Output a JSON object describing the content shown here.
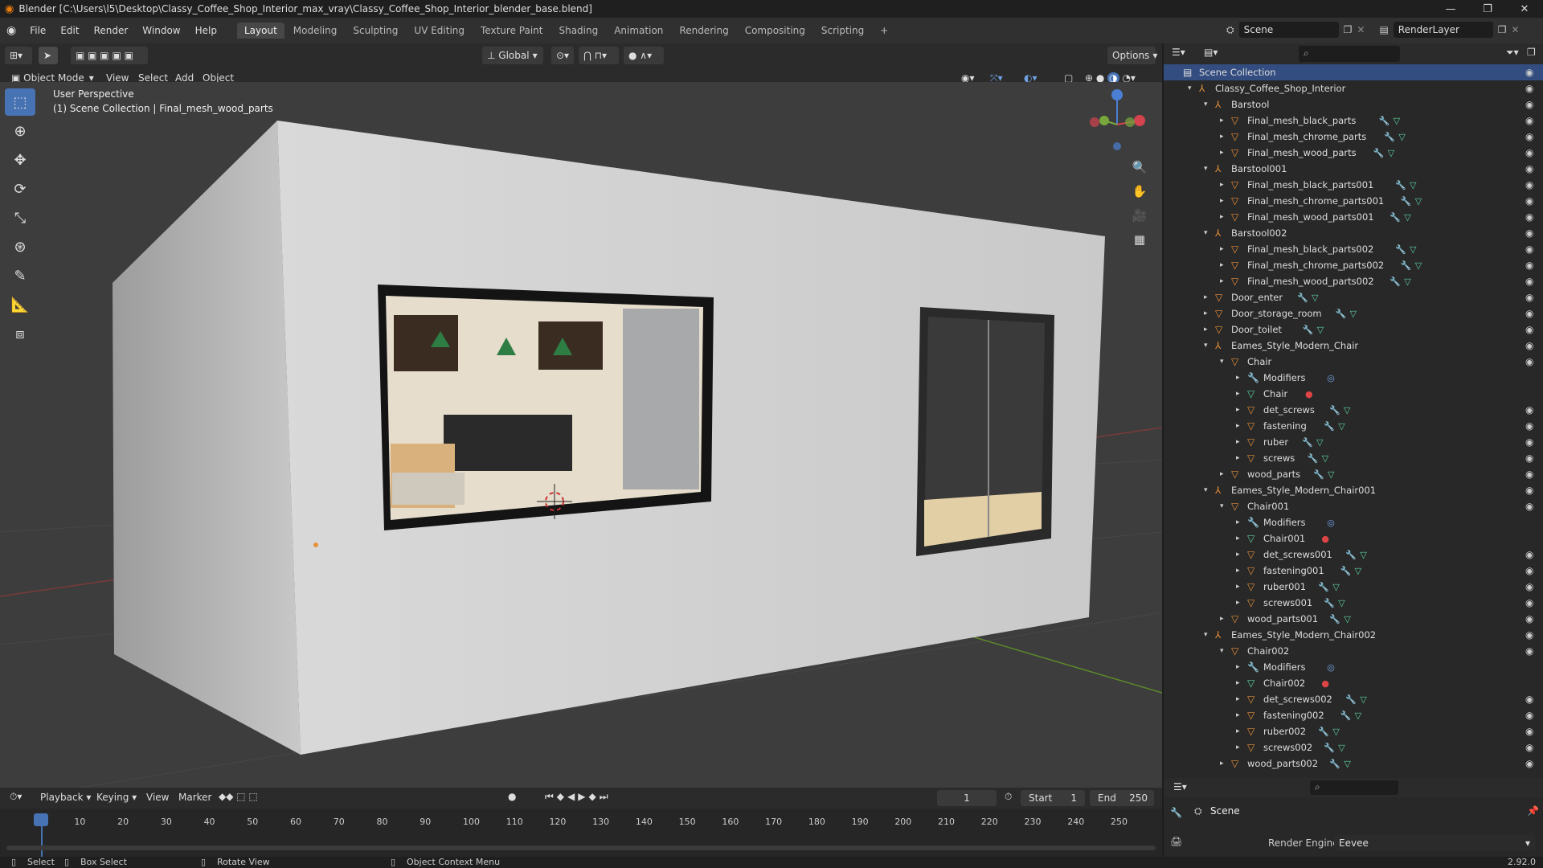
{
  "window": {
    "title": "Blender [C:\\Users\\l5\\Desktop\\Classy_Coffee_Shop_Interior_max_vray\\Classy_Coffee_Shop_Interior_blender_base.blend]",
    "minimize": "—",
    "restore": "❐",
    "close": "✕"
  },
  "menus": [
    "File",
    "Edit",
    "Render",
    "Window",
    "Help"
  ],
  "workspaces": [
    "Layout",
    "Modeling",
    "Sculpting",
    "UV Editing",
    "Texture Paint",
    "Shading",
    "Animation",
    "Rendering",
    "Compositing",
    "Scripting"
  ],
  "add_workspace": "+",
  "scene_name": "Scene",
  "render_layer": "RenderLayer",
  "viewport": {
    "mode": "Object Mode",
    "menu": [
      "View",
      "Select",
      "Add",
      "Object"
    ],
    "transform": "Global",
    "options": "Options",
    "perspective_label": "User Perspective",
    "collection_label": "(1) Scene Collection | Final_mesh_wood_parts"
  },
  "outliner": {
    "search_placeholder": "",
    "rows": [
      {
        "label": "Scene Collection",
        "type": "scene",
        "indent": 0,
        "selected": true
      },
      {
        "label": "Classy_Coffee_Shop_Interior",
        "type": "empty",
        "indent": 1,
        "arrow": "▾"
      },
      {
        "label": "Barstool",
        "type": "empty",
        "indent": 2,
        "arrow": "▾"
      },
      {
        "label": "Final_mesh_black_parts",
        "type": "mesh",
        "indent": 3,
        "arrow": "▸"
      },
      {
        "label": "Final_mesh_chrome_parts",
        "type": "mesh",
        "indent": 3,
        "arrow": "▸"
      },
      {
        "label": "Final_mesh_wood_parts",
        "type": "mesh",
        "indent": 3,
        "arrow": "▸"
      },
      {
        "label": "Barstool001",
        "type": "empty",
        "indent": 2,
        "arrow": "▾"
      },
      {
        "label": "Final_mesh_black_parts001",
        "type": "mesh",
        "indent": 3,
        "arrow": "▸"
      },
      {
        "label": "Final_mesh_chrome_parts001",
        "type": "mesh",
        "indent": 3,
        "arrow": "▸"
      },
      {
        "label": "Final_mesh_wood_parts001",
        "type": "mesh",
        "indent": 3,
        "arrow": "▸"
      },
      {
        "label": "Barstool002",
        "type": "empty",
        "indent": 2,
        "arrow": "▾"
      },
      {
        "label": "Final_mesh_black_parts002",
        "type": "mesh",
        "indent": 3,
        "arrow": "▸"
      },
      {
        "label": "Final_mesh_chrome_parts002",
        "type": "mesh",
        "indent": 3,
        "arrow": "▸"
      },
      {
        "label": "Final_mesh_wood_parts002",
        "type": "mesh",
        "indent": 3,
        "arrow": "▸"
      },
      {
        "label": "Door_enter",
        "type": "mesh",
        "indent": 2,
        "arrow": "▸"
      },
      {
        "label": "Door_storage_room",
        "type": "mesh",
        "indent": 2,
        "arrow": "▸"
      },
      {
        "label": "Door_toilet",
        "type": "mesh",
        "indent": 2,
        "arrow": "▸"
      },
      {
        "label": "Eames_Style_Modern_Chair",
        "type": "empty",
        "indent": 2,
        "arrow": "▾"
      },
      {
        "label": "Chair",
        "type": "mesh",
        "indent": 3,
        "arrow": "▾",
        "noicons": true
      },
      {
        "label": "Modifiers",
        "type": "modifiers",
        "indent": 4,
        "arrow": "▸"
      },
      {
        "label": "Chair",
        "type": "data",
        "indent": 4,
        "arrow": "▸"
      },
      {
        "label": "det_screws",
        "type": "mesh",
        "indent": 4,
        "arrow": "▸"
      },
      {
        "label": "fastening",
        "type": "mesh",
        "indent": 4,
        "arrow": "▸"
      },
      {
        "label": "ruber",
        "type": "mesh",
        "indent": 4,
        "arrow": "▸"
      },
      {
        "label": "screws",
        "type": "mesh",
        "indent": 4,
        "arrow": "▸"
      },
      {
        "label": "wood_parts",
        "type": "mesh",
        "indent": 3,
        "arrow": "▸"
      },
      {
        "label": "Eames_Style_Modern_Chair001",
        "type": "empty",
        "indent": 2,
        "arrow": "▾"
      },
      {
        "label": "Chair001",
        "type": "mesh",
        "indent": 3,
        "arrow": "▾",
        "noicons": true
      },
      {
        "label": "Modifiers",
        "type": "modifiers",
        "indent": 4,
        "arrow": "▸"
      },
      {
        "label": "Chair001",
        "type": "data",
        "indent": 4,
        "arrow": "▸"
      },
      {
        "label": "det_screws001",
        "type": "mesh",
        "indent": 4,
        "arrow": "▸"
      },
      {
        "label": "fastening001",
        "type": "mesh",
        "indent": 4,
        "arrow": "▸"
      },
      {
        "label": "ruber001",
        "type": "mesh",
        "indent": 4,
        "arrow": "▸"
      },
      {
        "label": "screws001",
        "type": "mesh",
        "indent": 4,
        "arrow": "▸"
      },
      {
        "label": "wood_parts001",
        "type": "mesh",
        "indent": 3,
        "arrow": "▸"
      },
      {
        "label": "Eames_Style_Modern_Chair002",
        "type": "empty",
        "indent": 2,
        "arrow": "▾"
      },
      {
        "label": "Chair002",
        "type": "mesh",
        "indent": 3,
        "arrow": "▾",
        "noicons": true
      },
      {
        "label": "Modifiers",
        "type": "modifiers",
        "indent": 4,
        "arrow": "▸"
      },
      {
        "label": "Chair002",
        "type": "data",
        "indent": 4,
        "arrow": "▸"
      },
      {
        "label": "det_screws002",
        "type": "mesh",
        "indent": 4,
        "arrow": "▸"
      },
      {
        "label": "fastening002",
        "type": "mesh",
        "indent": 4,
        "arrow": "▸"
      },
      {
        "label": "ruber002",
        "type": "mesh",
        "indent": 4,
        "arrow": "▸"
      },
      {
        "label": "screws002",
        "type": "mesh",
        "indent": 4,
        "arrow": "▸"
      },
      {
        "label": "wood_parts002",
        "type": "mesh",
        "indent": 3,
        "arrow": "▸"
      }
    ]
  },
  "timeline": {
    "menu": [
      "Playback",
      "Keying",
      "View",
      "Marker"
    ],
    "current_frame": "1",
    "start_label": "Start",
    "start": "1",
    "end_label": "End",
    "end": "250",
    "ticks": [
      "1",
      "10",
      "20",
      "30",
      "40",
      "50",
      "60",
      "70",
      "80",
      "90",
      "100",
      "110",
      "120",
      "130",
      "140",
      "150",
      "160",
      "170",
      "180",
      "190",
      "200",
      "210",
      "220",
      "230",
      "240",
      "250"
    ]
  },
  "properties": {
    "scene_label": "Scene",
    "render_engine_label": "Render Engine",
    "render_engine": "Eevee"
  },
  "status": {
    "select": "Select",
    "box_select": "Box Select",
    "rotate_view": "Rotate View",
    "context_menu": "Object Context Menu",
    "version": "2.92.0"
  },
  "colors": {
    "accent": "#4772b3",
    "object_orange": "#e8913a",
    "mesh_green": "#5ed3a0",
    "modifier_blue": "#6fa0e0"
  }
}
